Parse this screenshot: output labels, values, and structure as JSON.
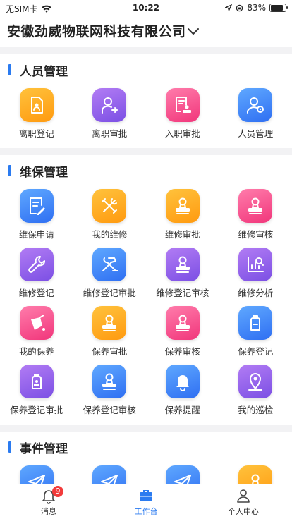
{
  "status_bar": {
    "carrier": "无SIM卡",
    "time": "10:22",
    "battery": "83%",
    "battery_level": 0.83
  },
  "header": {
    "company": "安徽劲威物联网科技有限公司"
  },
  "sections": [
    {
      "title": "人员管理",
      "items": [
        {
          "label": "离职登记",
          "color": "orange",
          "icon": "document-user-icon"
        },
        {
          "label": "离职审批",
          "color": "purple",
          "icon": "person-leave-icon"
        },
        {
          "label": "入职审批",
          "color": "pink",
          "icon": "document-stamp-icon"
        },
        {
          "label": "人员管理",
          "color": "blue",
          "icon": "user-settings-icon"
        }
      ]
    },
    {
      "title": "维保管理",
      "items": [
        {
          "label": "维保申请",
          "color": "blue",
          "icon": "edit-document-icon"
        },
        {
          "label": "我的维修",
          "color": "orange",
          "icon": "tools-icon"
        },
        {
          "label": "维修审批",
          "color": "orange",
          "icon": "stamp-icon"
        },
        {
          "label": "维修审核",
          "color": "pink",
          "icon": "stamp-icon"
        },
        {
          "label": "维修登记",
          "color": "purple",
          "icon": "wrench-icon"
        },
        {
          "label": "维修登记审批",
          "color": "blue",
          "icon": "hammer-wrench-icon"
        },
        {
          "label": "维修登记审核",
          "color": "purple",
          "icon": "stamp-icon"
        },
        {
          "label": "维修分析",
          "color": "purple",
          "icon": "chart-analysis-icon"
        },
        {
          "label": "我的保养",
          "color": "pink",
          "icon": "oil-can-icon"
        },
        {
          "label": "保养审批",
          "color": "orange",
          "icon": "stamp-icon"
        },
        {
          "label": "保养审核",
          "color": "pink",
          "icon": "stamp-icon"
        },
        {
          "label": "保养登记",
          "color": "blue",
          "icon": "bottle-icon"
        },
        {
          "label": "保养登记审批",
          "color": "purple",
          "icon": "bottle-stamp-icon"
        },
        {
          "label": "保养登记审核",
          "color": "blue",
          "icon": "stamp-icon"
        },
        {
          "label": "保养提醒",
          "color": "blue",
          "icon": "bell-icon"
        },
        {
          "label": "我的巡检",
          "color": "purple",
          "icon": "location-pin-icon"
        }
      ]
    },
    {
      "title": "事件管理",
      "items": [
        {
          "label": "",
          "color": "blue",
          "icon": "send-icon"
        },
        {
          "label": "",
          "color": "blue",
          "icon": "send-icon"
        },
        {
          "label": "",
          "color": "blue",
          "icon": "send-icon"
        },
        {
          "label": "",
          "color": "orange",
          "icon": "stamp-icon"
        }
      ]
    }
  ],
  "tabbar": [
    {
      "label": "消息",
      "icon": "bell-icon",
      "badge": "9",
      "active": false
    },
    {
      "label": "工作台",
      "icon": "briefcase-icon",
      "active": true
    },
    {
      "label": "个人中心",
      "icon": "person-icon",
      "active": false
    }
  ],
  "colors": {
    "accent": "#2b7bf0",
    "badge": "#f23b3b"
  }
}
